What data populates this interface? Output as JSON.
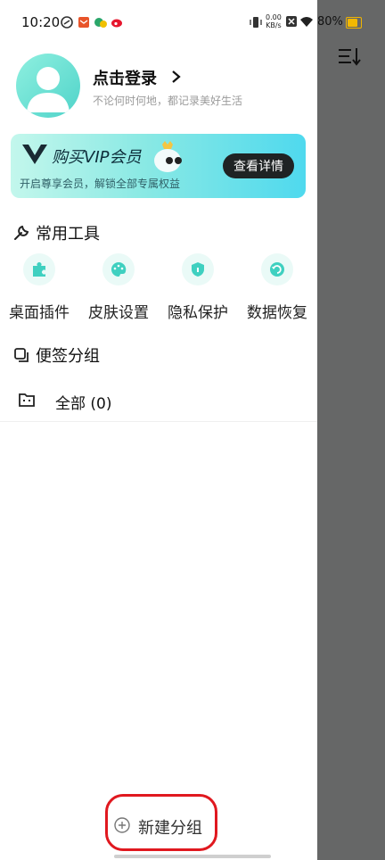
{
  "status_bar": {
    "time": "10:20",
    "net_speed_value": "0.00",
    "net_speed_unit": "KB/s",
    "battery": "80%"
  },
  "profile": {
    "login_label": "点击登录",
    "subtitle": "不论何时何地，都记录美好生活"
  },
  "vip": {
    "title": "购买VIP会员",
    "subtitle": "开启尊享会员，解锁全部专属权益",
    "button": "查看详情"
  },
  "tools": {
    "title": "常用工具",
    "items": [
      {
        "label": "桌面插件",
        "icon": "puzzle-icon"
      },
      {
        "label": "皮肤设置",
        "icon": "palette-icon"
      },
      {
        "label": "隐私保护",
        "icon": "shield-icon"
      },
      {
        "label": "数据恢复",
        "icon": "restore-icon"
      }
    ]
  },
  "groups": {
    "title": "便签分组",
    "items": [
      {
        "label": "全部 (0)",
        "icon": "folder-icon"
      }
    ],
    "new_group": "新建分组"
  },
  "colors": {
    "accent": "#4fd3c9",
    "vip_button": "#1f2324",
    "highlight": "#e0181f",
    "battery": "#f2b800"
  }
}
